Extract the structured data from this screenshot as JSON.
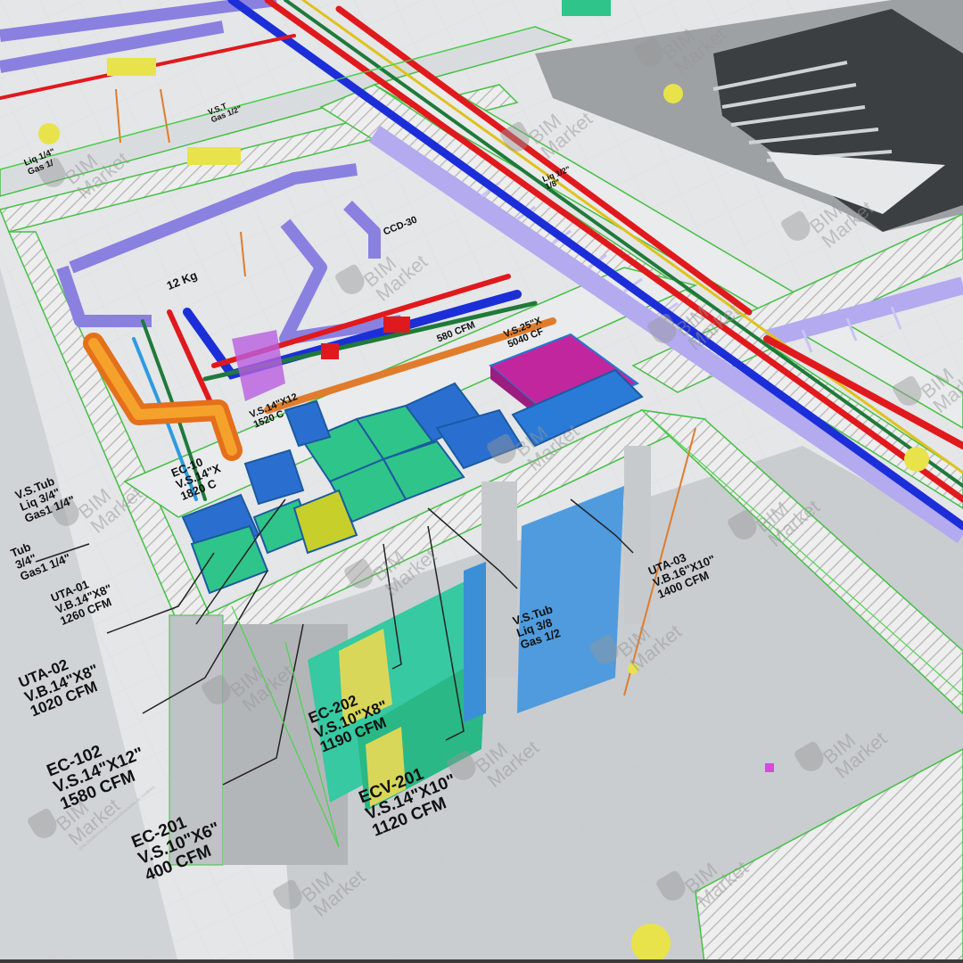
{
  "watermark": {
    "line1": "BIM",
    "line2": "Market",
    "tagline": "Uma plataforma de compartilhamento de modelos"
  },
  "labels": {
    "vs_tub_left": [
      "V.S.Tub",
      "Liq 3/4\"",
      "Gas1 1/4\""
    ],
    "vs_tub_left2": [
      "Tub",
      "3/4\"",
      "Gas1 1/4\""
    ],
    "uta01": [
      "UTA-01",
      "V.B.14\"X8\"",
      "1260 CFM"
    ],
    "uta02": [
      "UTA-02",
      "V.B.14\"X8\"",
      "1020 CFM"
    ],
    "ec102": [
      "EC-102",
      "V.S.14\"X12\"",
      "1580 CFM"
    ],
    "ec201": [
      "EC-201",
      "V.S.10\"X6\"",
      "400 CFM"
    ],
    "ec202": [
      "EC-202",
      "V.S.10\"X8\"",
      "1190 CFM"
    ],
    "ecv201": [
      "ECV-201",
      "V.S.14\"X10\"",
      "1120 CFM"
    ],
    "vs_tub_center": [
      "V.S.Tub",
      "Liq 3/8",
      "Gas 1/2"
    ],
    "uta03": [
      "UTA-03",
      "V.B.16\"X10\"",
      "1400 CFM"
    ],
    "ec10x": [
      "EC-10",
      "V.S.14\"X",
      "1820 C"
    ],
    "vs25": [
      "V.S.25\"X",
      "5040 CF"
    ],
    "cfm580": [
      "580 CFM"
    ],
    "vs14": [
      "V.S.14\"X12",
      "1520 C"
    ],
    "kg12": [
      "12 Kg"
    ],
    "ccd30": [
      "CCD-30"
    ],
    "liq_gas_top": [
      "Liq 1/4\"",
      "Gas 1/"
    ],
    "top_misc1": [
      "Liq 1/2\"",
      "1/8\""
    ],
    "top_misc2": [
      "V.S.T",
      "Gas 1/2\""
    ]
  }
}
